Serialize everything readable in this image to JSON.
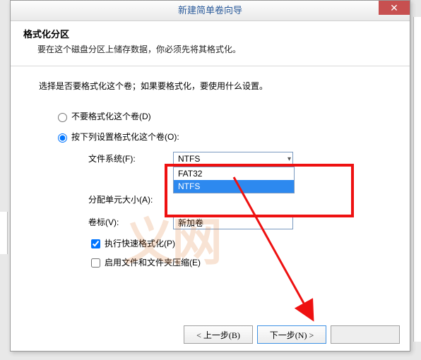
{
  "window": {
    "title": "新建简单卷向导"
  },
  "header": {
    "title": "格式化分区",
    "subtitle": "要在这个磁盘分区上储存数据，你必须先将其格式化。"
  },
  "prompt": "选择是否要格式化这个卷；如果要格式化，要使用什么设置。",
  "radios": {
    "no_format": "不要格式化这个卷(D)",
    "do_format": "按下列设置格式化这个卷(O):"
  },
  "fields": {
    "filesystem_label": "文件系统(F):",
    "filesystem_value": "NTFS",
    "options": [
      "FAT32",
      "NTFS"
    ],
    "alloc_label": "分配单元大小(A):",
    "vol_label": "卷标(V):",
    "vol_value": "新加卷"
  },
  "checks": {
    "quick": "执行快速格式化(P)",
    "compress": "启用文件和文件夹压缩(E)"
  },
  "buttons": {
    "back": "< 上一步(B)",
    "next": "下一步(N) >"
  },
  "watermark": "义网"
}
